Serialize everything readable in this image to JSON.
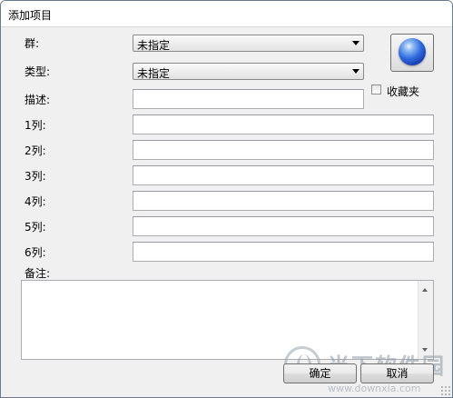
{
  "window": {
    "title": "添加项目"
  },
  "form": {
    "group_label": "群:",
    "group_value": "未指定",
    "type_label": "类型:",
    "type_value": "未指定",
    "desc_label": "描述:",
    "favorites_label": "收藏夹",
    "favorites_checked": false,
    "columns": [
      {
        "label": "1列:",
        "value": ""
      },
      {
        "label": "2列:",
        "value": ""
      },
      {
        "label": "3列:",
        "value": ""
      },
      {
        "label": "4列:",
        "value": ""
      },
      {
        "label": "5列:",
        "value": ""
      },
      {
        "label": "6列:",
        "value": ""
      }
    ],
    "notes_label": "备注:",
    "notes_value": ""
  },
  "buttons": {
    "ok": "确定",
    "cancel": "取消"
  },
  "watermark": {
    "text": "当下软件园",
    "url": "www.downxia.com"
  },
  "icons": {
    "icon_button": "blue-orb-icon"
  }
}
